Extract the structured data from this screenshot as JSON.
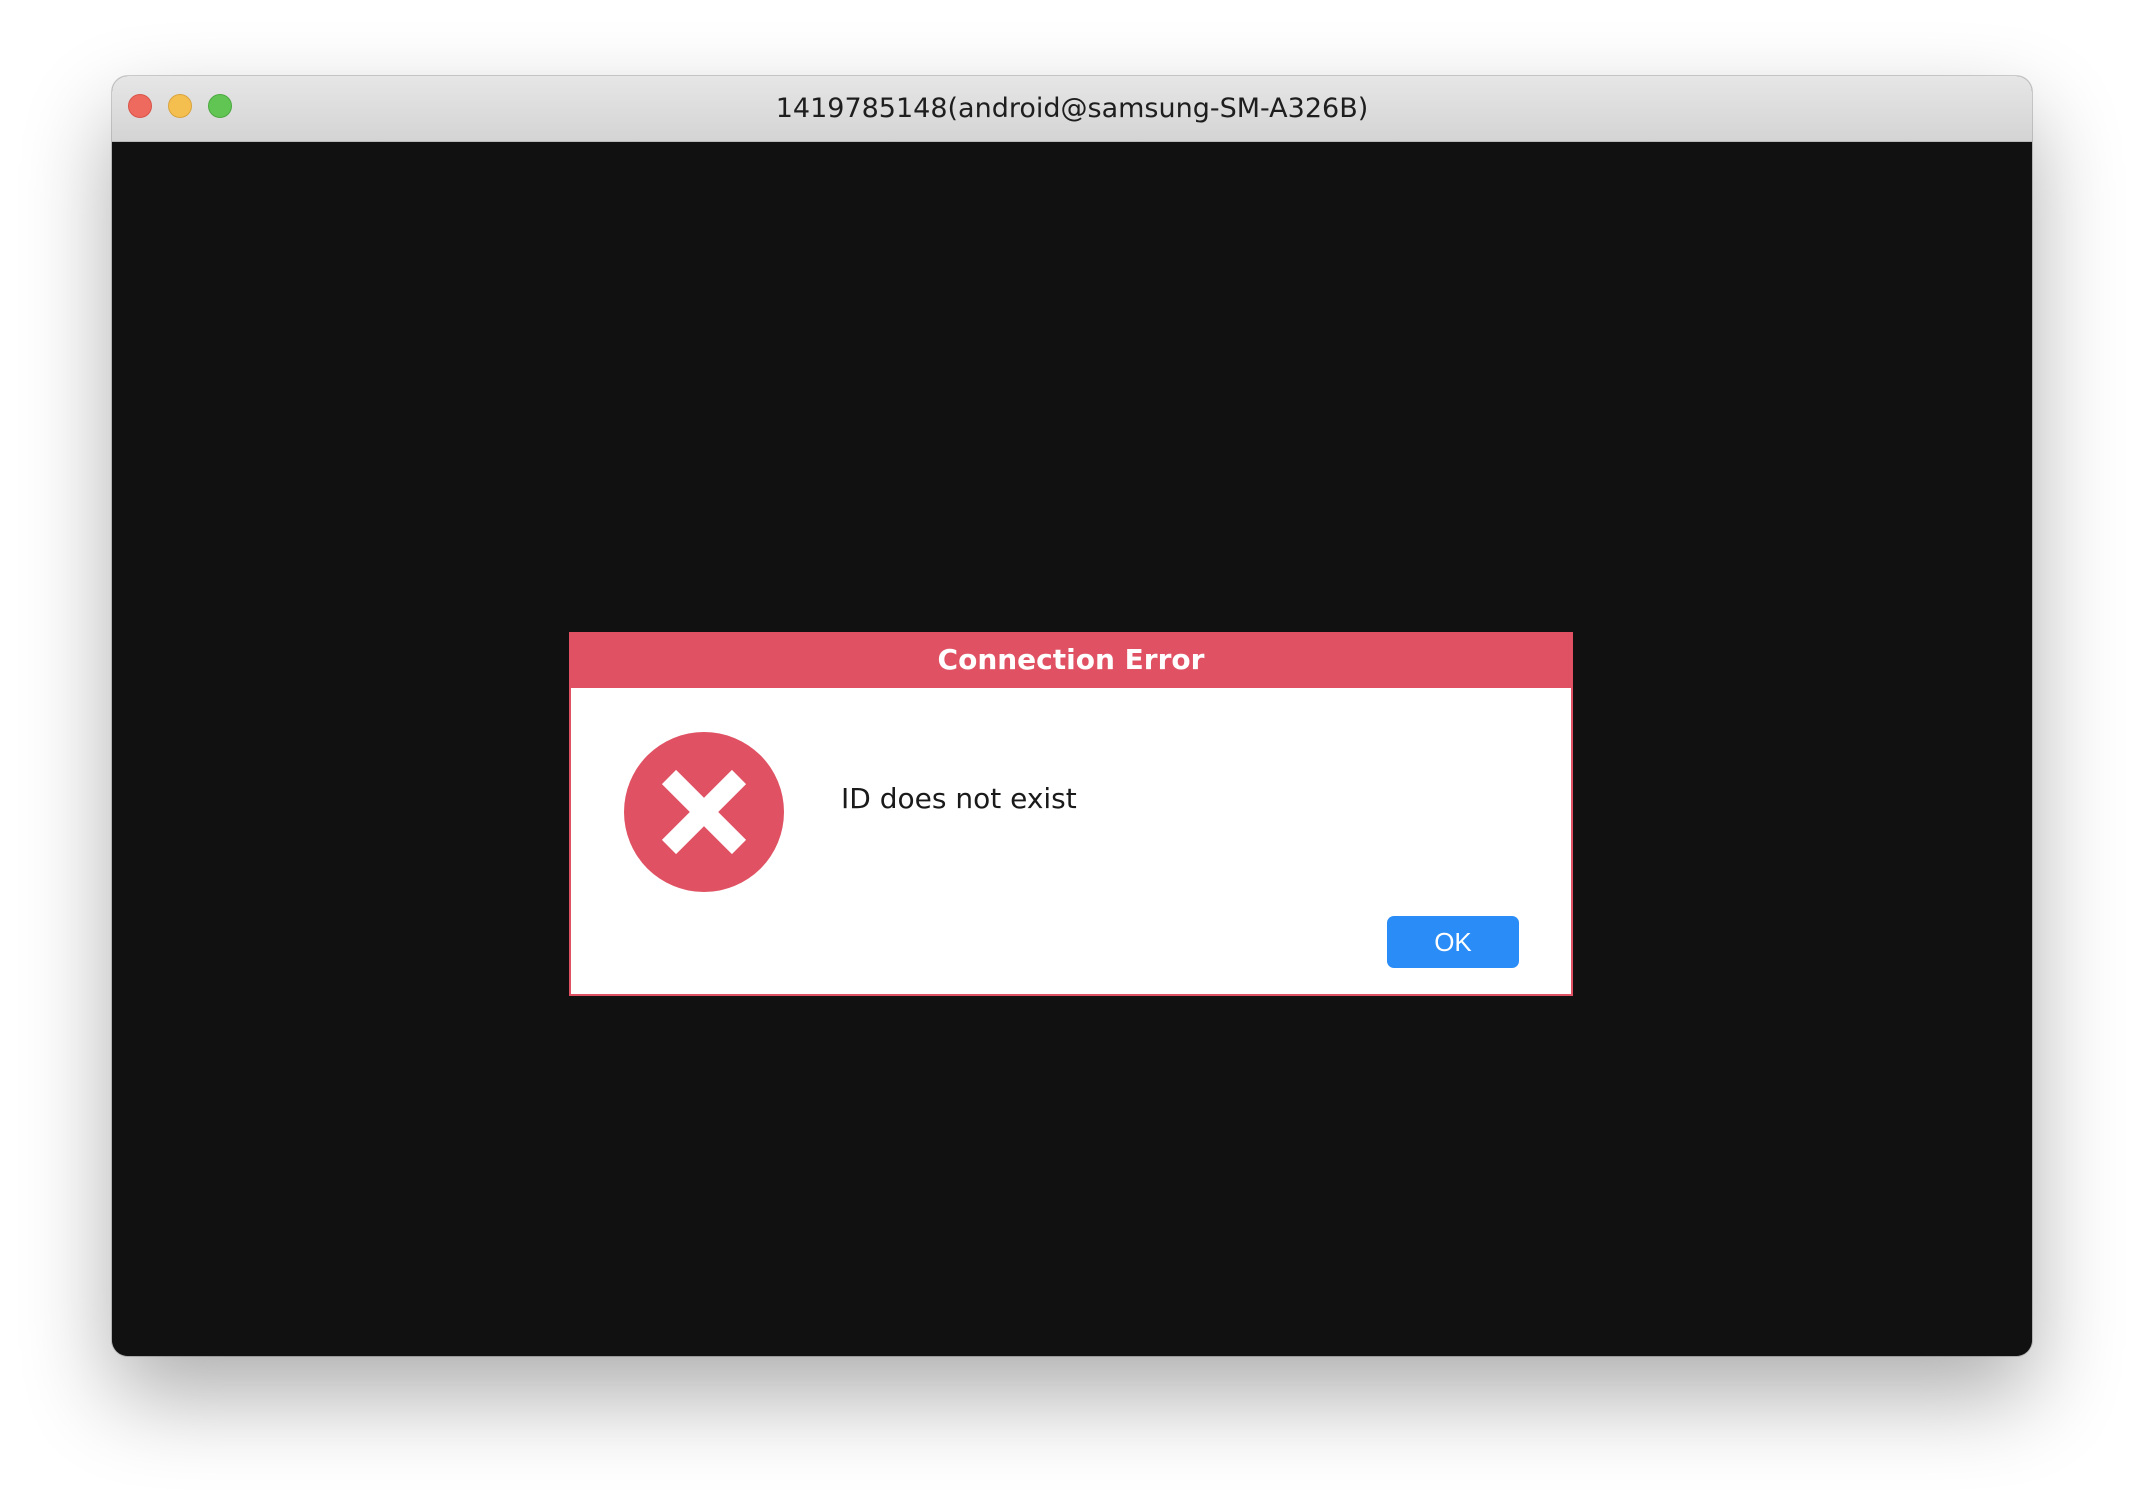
{
  "window": {
    "title": "1419785148(android@samsung-SM-A326B)",
    "controls": {
      "close_icon": "close-dot-icon",
      "minimize_icon": "minimize-dot-icon",
      "zoom_icon": "zoom-dot-icon"
    }
  },
  "dialog": {
    "title": "Connection Error",
    "icon": "error-x-icon",
    "message": "ID does not exist",
    "ok_label": "OK"
  },
  "colors": {
    "accent_error": "#e05263",
    "button_blue": "#2a8cf6",
    "background_dark": "#111111"
  }
}
